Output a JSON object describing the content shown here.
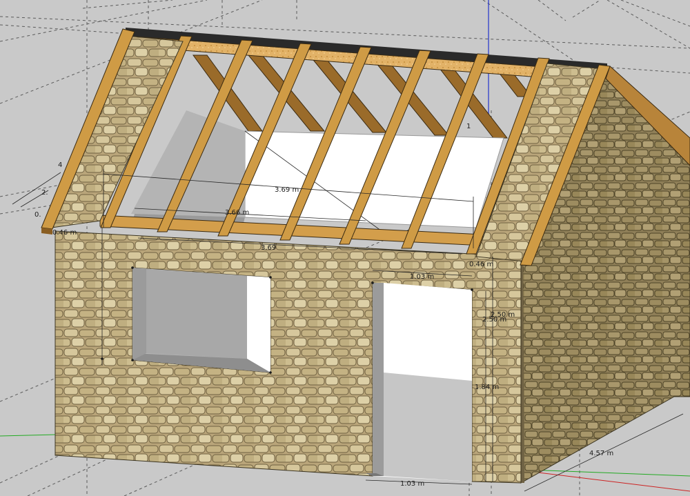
{
  "scene": {
    "background": "#c9c9c9",
    "colors": {
      "stone": "#b9a57a",
      "stone_dark": "#8a7a55",
      "timber": "#cf9b45",
      "osb_board": "#e2b267",
      "interior_wall": "#ffffff",
      "interior_shadow": "#b4b4b4",
      "red_axis": "#cc2222",
      "green_axis": "#22aa22",
      "blue_axis": "#2233cc"
    },
    "dimensions": {
      "top_span": "3.69 m",
      "inner_span": "3.66 m",
      "front_span": "3.69",
      "eave_left": "0.46 m",
      "eave_right": "0.46 m",
      "door_width_top": "1.03 m",
      "door_width_bottom": "1.03 m",
      "wall_height_outer": "2.50 m",
      "wall_height_inner": "2.50 m",
      "door_height": "1.84 m",
      "side_depth": "4.57 m",
      "clip_left_1": "4",
      "clip_left_2": "2.",
      "clip_left_3": "0.",
      "clip_ridge": "1"
    }
  }
}
